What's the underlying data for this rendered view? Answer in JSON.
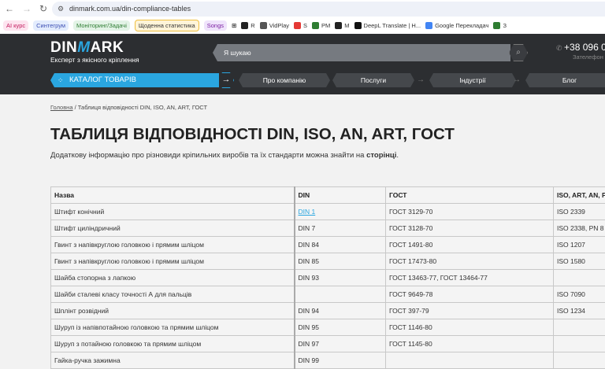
{
  "browser": {
    "url": "dinmark.com.ua/din-compliance-tables",
    "bookmarks_chips": [
      {
        "label": "AI курс",
        "bg": "#fde4ef",
        "color": "#c2185b"
      },
      {
        "label": "Синтегрум",
        "bg": "#e3ecfd",
        "color": "#3f51b5"
      },
      {
        "label": "Моніторинг/Задачі",
        "bg": "#e3f3e6",
        "color": "#2e7d32"
      },
      {
        "label": "Щоденна статистика",
        "bg": "#fff4d8",
        "color": "#333"
      },
      {
        "label": "Songs",
        "bg": "#efe3fb",
        "color": "#7b1fa2"
      }
    ],
    "bookmarks": [
      "R",
      "VidPlay",
      "S",
      "PM",
      "M",
      "DeepL Translate | H...",
      "Google Перекладач",
      "З"
    ]
  },
  "site": {
    "logo": "DINMARK",
    "tagline": "Експерт з якісного кріплення",
    "search_placeholder": "Я шукаю",
    "phone": "+38 096 0",
    "phone_sub": "Зателефон",
    "catalog": "КАТАЛОГ ТОВАРІВ",
    "menu": [
      "Про компанію",
      "Послуги",
      "Індустрії",
      "Блог"
    ],
    "accent": "#2aa6e0"
  },
  "breadcrumb": {
    "home": "Головна",
    "sep": "/",
    "current": "Таблиця відповідності DIN, ISO, AN, ART, ГОСТ"
  },
  "title": "ТАБЛИЦЯ ВІДПОВІДНОСТІ DIN, ISO, AN, ART, ГОСТ",
  "intro": {
    "text": "Додаткову інформацію про різновиди кріпильних виробів та їх стандарти можна знайти на ",
    "link": "сторінці",
    "end": "."
  },
  "table": {
    "headers": [
      "Назва",
      "DIN",
      "ГОСТ",
      "ISO, ART, AN, P"
    ],
    "rows": [
      [
        "Штифт конічний",
        "DIN 1",
        "ГОСТ 3129-70",
        "ISO 2339"
      ],
      [
        "Штифт циліндричний",
        "DIN 7",
        "ГОСТ 3128-70",
        "ISO 2338, PN 8"
      ],
      [
        "Гвинт з напівкруглою головкою і прямим шліцом",
        "DIN 84",
        "ГОСТ 1491-80",
        "ISO 1207"
      ],
      [
        "Гвинт з напівкруглою головкою і прямим шліцом",
        "DIN 85",
        "ГОСТ 17473-80",
        "ISO 1580"
      ],
      [
        "Шайба стопорна з лапкою",
        "DIN 93",
        "ГОСТ 13463-77, ГОСТ 13464-77",
        ""
      ],
      [
        "Шайби сталеві класу точності А для пальців",
        "",
        "ГОСТ 9649-78",
        "ISO 7090"
      ],
      [
        "Шплінт розвідний",
        "DIN 94",
        "ГОСТ 397-79",
        "ISO 1234"
      ],
      [
        "Шуруп із напівпотайною головкою та прямим шліцом",
        "DIN 95",
        "ГОСТ 1146-80",
        ""
      ],
      [
        "Шуруп з потайною головкою та прямим шліцом",
        "DIN 97",
        "ГОСТ 1145-80",
        ""
      ],
      [
        "Гайка-ручка зажимна",
        "DIN 99",
        "",
        ""
      ]
    ]
  }
}
